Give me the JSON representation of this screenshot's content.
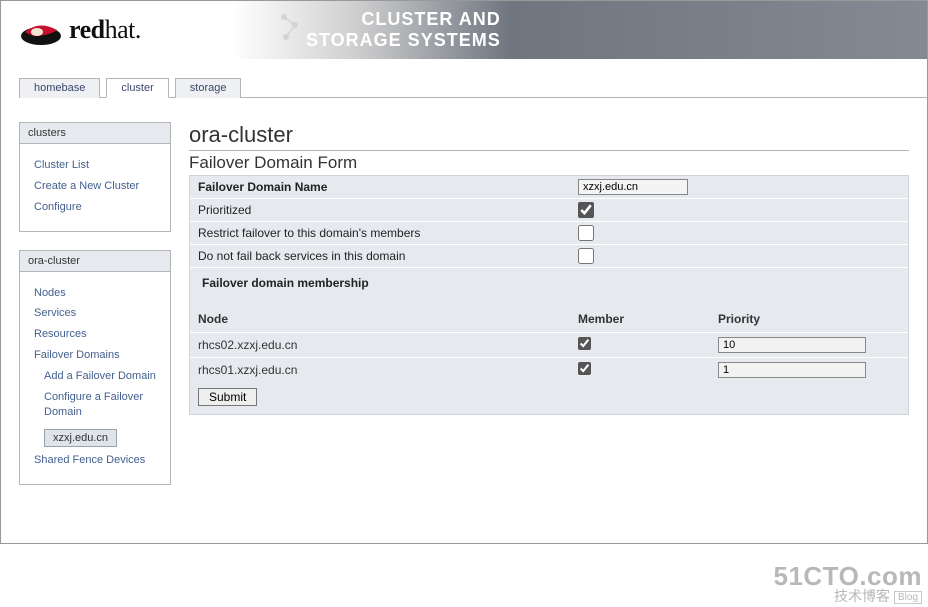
{
  "header": {
    "brand_bold": "red",
    "brand_rest": "hat.",
    "title_line1": "CLUSTER AND",
    "title_line2": "STORAGE SYSTEMS"
  },
  "tabs": {
    "homebase": "homebase",
    "cluster": "cluster",
    "storage": "storage"
  },
  "sidebar": {
    "clusters": {
      "title": "clusters",
      "cluster_list": "Cluster List",
      "create_new": "Create a New Cluster",
      "configure": "Configure"
    },
    "oracluster": {
      "title": "ora-cluster",
      "nodes": "Nodes",
      "services": "Services",
      "resources": "Resources",
      "failover_domains": "Failover Domains",
      "add_failover": "Add a Failover Domain",
      "configure_failover": "Configure a Failover Domain",
      "selected_domain": "xzxj.edu.cn",
      "shared_fence": "Shared Fence Devices"
    }
  },
  "main": {
    "page_title": "ora-cluster",
    "form_title": "Failover Domain Form",
    "labels": {
      "name": "Failover Domain Name",
      "prioritized": "Prioritized",
      "restrict": "Restrict failover to this domain's members",
      "nofailback": "Do not fail back services in this domain",
      "membership": "Failover domain membership",
      "node": "Node",
      "member": "Member",
      "priority": "Priority",
      "submit": "Submit"
    },
    "values": {
      "name": "xzxj.edu.cn",
      "prioritized": true,
      "restrict": false,
      "nofailback": false
    },
    "members": [
      {
        "node": "rhcs02.xzxj.edu.cn",
        "member": true,
        "priority": "10"
      },
      {
        "node": "rhcs01.xzxj.edu.cn",
        "member": true,
        "priority": "1"
      }
    ]
  },
  "watermark": {
    "l1": "51CTO.com",
    "l2": "技术博客",
    "blog": "Blog"
  }
}
